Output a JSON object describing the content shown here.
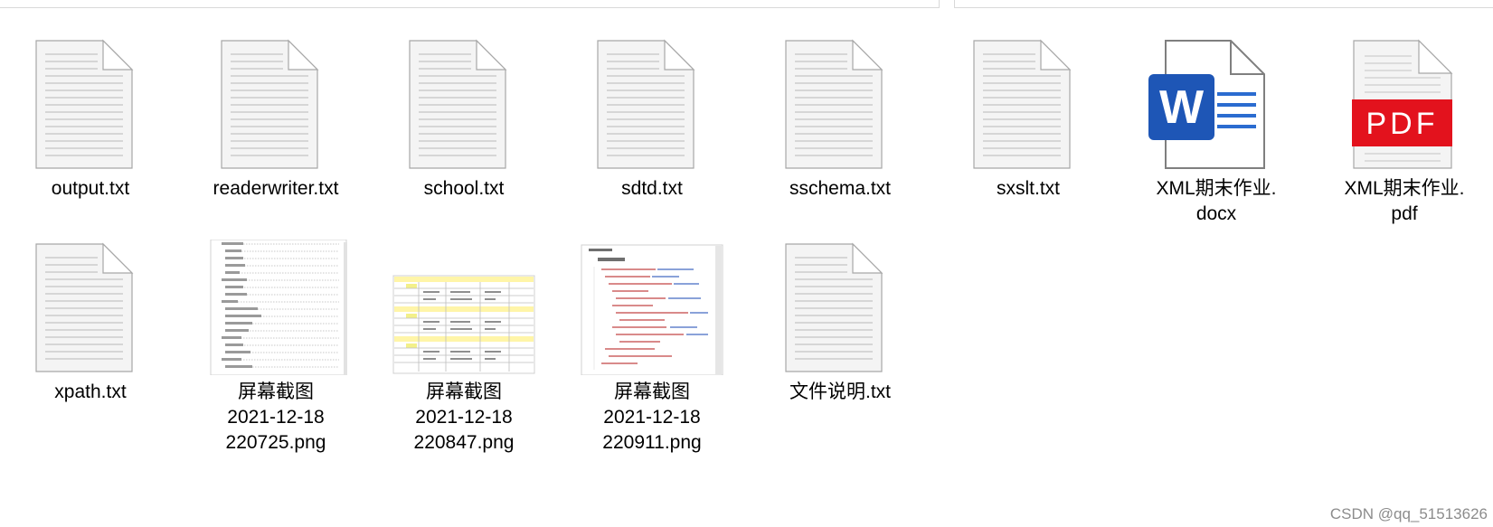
{
  "files": [
    {
      "label": "output.txt",
      "type": "txt"
    },
    {
      "label": "readerwriter.txt",
      "type": "txt"
    },
    {
      "label": "school.txt",
      "type": "txt"
    },
    {
      "label": "sdtd.txt",
      "type": "txt"
    },
    {
      "label": "sschema.txt",
      "type": "txt"
    },
    {
      "label": "sxslt.txt",
      "type": "txt"
    },
    {
      "label": "XML期末作业.\ndocx",
      "type": "docx"
    },
    {
      "label": "XML期末作业.\npdf",
      "type": "pdf"
    },
    {
      "label": "xpath.txt",
      "type": "txt"
    },
    {
      "label": "屏幕截图\n2021-12-18\n220725.png",
      "type": "png-toc"
    },
    {
      "label": "屏幕截图\n2021-12-18\n220847.png",
      "type": "png-table"
    },
    {
      "label": "屏幕截图\n2021-12-18\n220911.png",
      "type": "png-code"
    },
    {
      "label": "文件说明.txt",
      "type": "txt"
    }
  ],
  "icons": {
    "word_letter": "W",
    "pdf_text": "PDF"
  },
  "colors": {
    "word_blue": "#1e56b6",
    "pdf_red": "#e3121d",
    "text_icon_gray": "#a7a7a7"
  },
  "watermark": "CSDN @qq_51513626"
}
